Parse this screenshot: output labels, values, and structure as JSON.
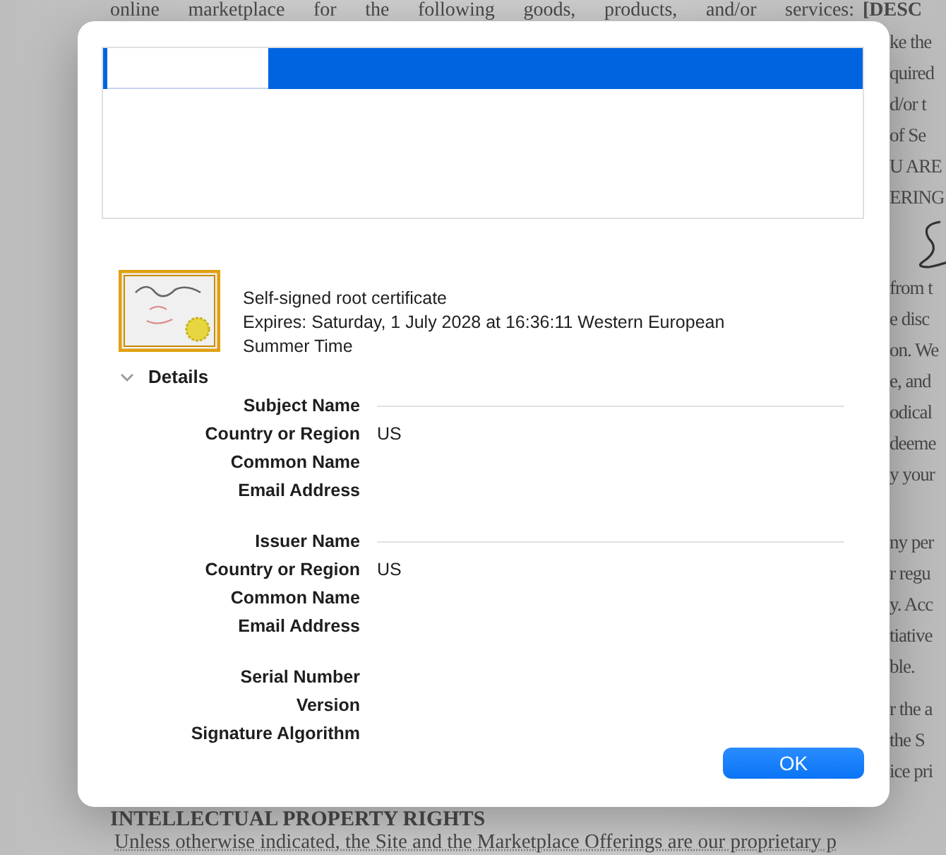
{
  "document": {
    "top_line": "online marketplace for the following goods, products, and/or services:",
    "top_line_bold": "[DESC",
    "paragraphs": [
      {
        "lines": [
          "ke the",
          "quired",
          "d/or t",
          "of Se",
          "U ARE",
          "ERING"
        ]
      },
      {
        "signature": true,
        "lines": [
          "from t",
          "e disc",
          "on. We",
          "e, and",
          "odical",
          "deeme",
          "y your"
        ]
      },
      {
        "lines": [
          "ny per",
          "r regu",
          "y. Acc",
          "tiative",
          "ble."
        ]
      },
      {
        "lines": [
          "r the a",
          "the S",
          "ice pri"
        ]
      }
    ],
    "heading": "INTELLECTUAL PROPERTY RIGHTS",
    "bottom_line": "Unless otherwise indicated, the Site and the Marketplace Offerings are our proprietary p"
  },
  "dialog": {
    "certificate": {
      "title": "Self-signed root certificate",
      "expires": "Expires: Saturday, 1 July 2028 at 16:36:11 Western European Summer Time"
    },
    "details": {
      "label": "Details",
      "expanded": true,
      "sections": [
        {
          "rows": [
            {
              "kind": "header",
              "label": "Subject Name"
            },
            {
              "kind": "field",
              "label": "Country or Region",
              "value": "US"
            },
            {
              "kind": "field",
              "label": "Common Name"
            },
            {
              "kind": "field",
              "label": "Email Address"
            }
          ]
        },
        {
          "rows": [
            {
              "kind": "header",
              "label": "Issuer Name"
            },
            {
              "kind": "field",
              "label": "Country or Region",
              "value": "US"
            },
            {
              "kind": "field",
              "label": "Common Name"
            },
            {
              "kind": "field",
              "label": "Email Address"
            }
          ]
        },
        {
          "rows": [
            {
              "kind": "field",
              "label": "Serial Number"
            },
            {
              "kind": "field",
              "label": "Version"
            },
            {
              "kind": "field",
              "label": "Signature Algorithm"
            }
          ]
        }
      ]
    },
    "buttons": [
      {
        "label": "OK",
        "kind": "default"
      }
    ]
  }
}
